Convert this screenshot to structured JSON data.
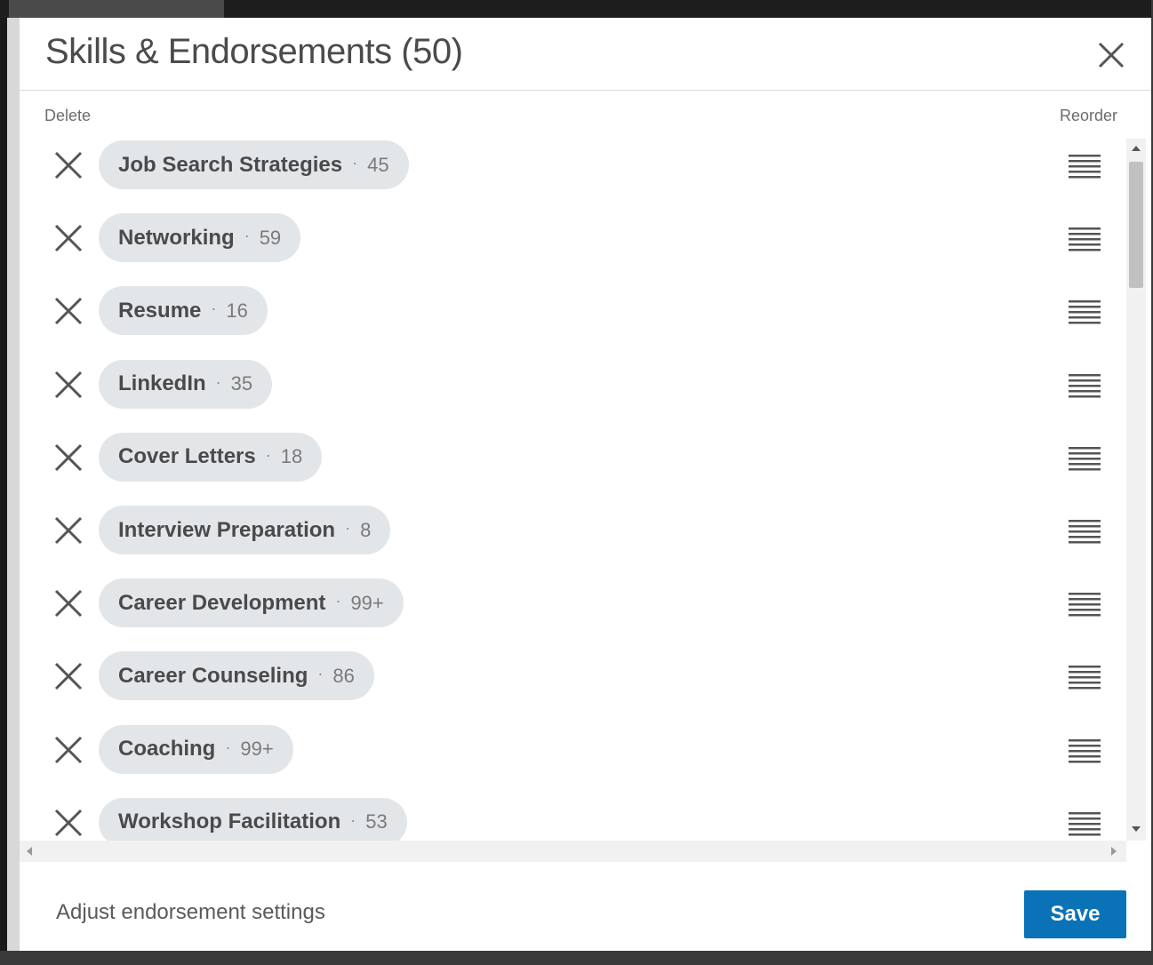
{
  "modal": {
    "title": "Skills & Endorsements (50)",
    "delete_label": "Delete",
    "reorder_label": "Reorder"
  },
  "skills": [
    {
      "name": "Job Search Strategies",
      "count": "45"
    },
    {
      "name": "Networking",
      "count": "59"
    },
    {
      "name": "Resume",
      "count": "16"
    },
    {
      "name": "LinkedIn",
      "count": "35"
    },
    {
      "name": "Cover Letters",
      "count": "18"
    },
    {
      "name": "Interview Preparation",
      "count": "8"
    },
    {
      "name": "Career Development",
      "count": "99+"
    },
    {
      "name": "Career Counseling",
      "count": "86"
    },
    {
      "name": "Coaching",
      "count": "99+"
    },
    {
      "name": "Workshop Facilitation",
      "count": "53"
    }
  ],
  "separator": "·",
  "footer": {
    "settings_link": "Adjust endorsement settings",
    "save_label": "Save"
  },
  "icons": {
    "close": "close-icon",
    "delete": "x-icon",
    "reorder": "drag-handle-icon"
  },
  "colors": {
    "accent": "#0a73b8",
    "pill_bg": "#e3e6e9",
    "text": "#4a4a4a"
  }
}
